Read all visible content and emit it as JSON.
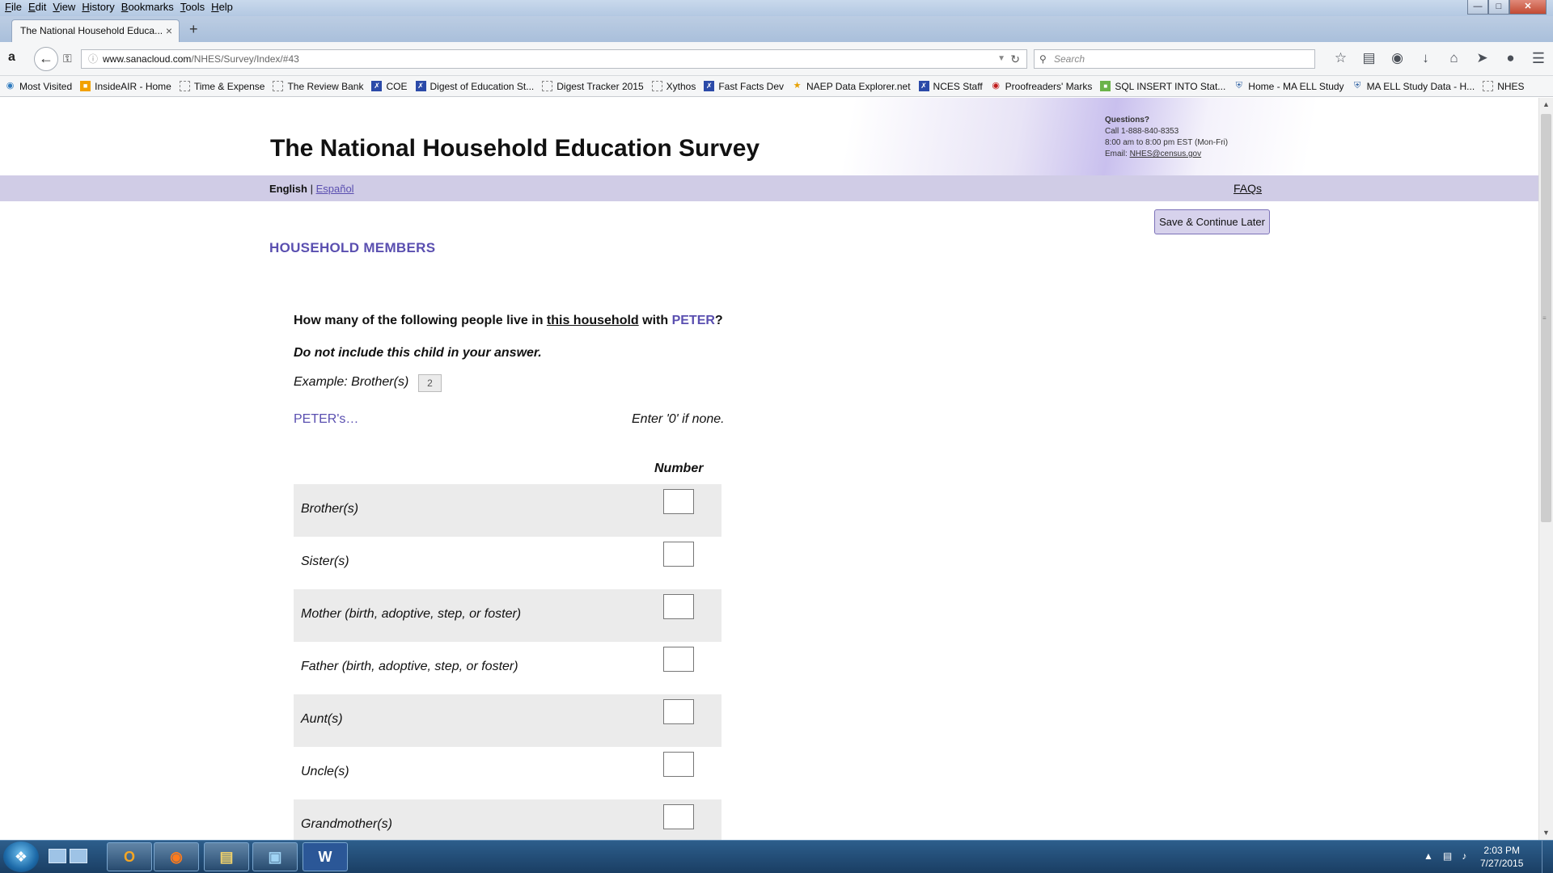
{
  "browser": {
    "menu": [
      "File",
      "Edit",
      "View",
      "History",
      "Bookmarks",
      "Tools",
      "Help"
    ],
    "tab_title": "The National Household Educa...",
    "url_host": "www.sanacloud.com",
    "url_path": "/NHES/Survey/Index/#43",
    "search_placeholder": "Search",
    "bookmarks": [
      {
        "label": "Most Visited",
        "icon": "globe-icon"
      },
      {
        "label": "InsideAIR - Home",
        "icon": "orange-square-icon"
      },
      {
        "label": "Time & Expense",
        "icon": "page-icon"
      },
      {
        "label": "The Review Bank",
        "icon": "page-icon"
      },
      {
        "label": "COE",
        "icon": "nces-icon"
      },
      {
        "label": "Digest of Education St...",
        "icon": "nces-icon"
      },
      {
        "label": "Digest Tracker 2015",
        "icon": "page-icon"
      },
      {
        "label": "Xythos",
        "icon": "page-icon"
      },
      {
        "label": "Fast Facts Dev",
        "icon": "nces-icon"
      },
      {
        "label": "NAEP Data Explorer.net",
        "icon": "star-icon"
      },
      {
        "label": "NCES Staff",
        "icon": "nces-icon"
      },
      {
        "label": "Proofreaders' Marks",
        "icon": "red-globe-icon"
      },
      {
        "label": "SQL INSERT INTO Stat...",
        "icon": "green-icon"
      },
      {
        "label": "Home - MA ELL Study",
        "icon": "shield-icon"
      },
      {
        "label": "MA ELL Study Data - H...",
        "icon": "shield-icon"
      },
      {
        "label": "NHES",
        "icon": "page-icon"
      }
    ]
  },
  "page": {
    "site_title": "The National Household Education Survey",
    "contact": {
      "heading": "Questions?",
      "phone": "Call 1-888-840-8353",
      "hours": "8:00 am to 8:00 pm EST (Mon-Fri)",
      "email_label": "Email:",
      "email": "NHES@census.gov"
    },
    "lang_current": "English",
    "lang_separator": "|",
    "lang_other": "Español",
    "faqs": "FAQs",
    "save_button": "Save & Continue Later",
    "section_title": "HOUSEHOLD MEMBERS",
    "question": {
      "part1": "How many of the following people live in ",
      "underlined": "this household",
      "part2": " with ",
      "name": "PETER",
      "end": "?"
    },
    "instruction": "Do not include this child in your answer.",
    "example_label": "Example: Brother(s)",
    "example_value": "2",
    "possessive": "PETER's…",
    "none_hint": "Enter '0' if none.",
    "column_header": "Number",
    "rows": [
      {
        "label": "Brother(s)",
        "value": ""
      },
      {
        "label": "Sister(s)",
        "value": ""
      },
      {
        "label": "Mother (birth, adoptive, step, or foster)",
        "value": ""
      },
      {
        "label": "Father (birth, adoptive, step, or foster)",
        "value": ""
      },
      {
        "label": "Aunt(s)",
        "value": ""
      },
      {
        "label": "Uncle(s)",
        "value": ""
      },
      {
        "label": "Grandmother(s)",
        "value": ""
      }
    ]
  },
  "taskbar": {
    "apps": [
      "outlook-icon",
      "firefox-icon",
      "file-explorer-icon",
      "remote-desktop-icon",
      "word-icon"
    ],
    "time": "2:03 PM",
    "date": "7/27/2015"
  }
}
